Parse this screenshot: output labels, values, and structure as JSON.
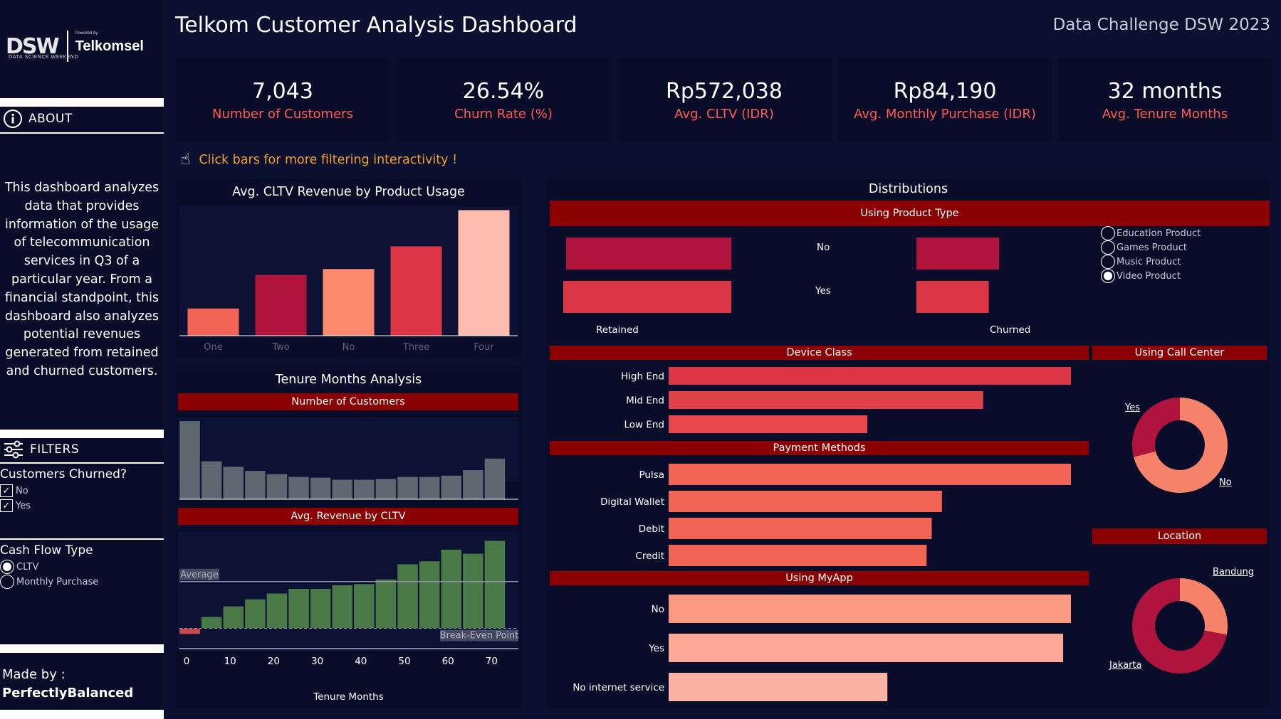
{
  "header": {
    "title": "Telkom Customer Analysis Dashboard",
    "event": "Data Challenge DSW 2023"
  },
  "logo": {
    "dsw": "DSW",
    "dsw_sub": "DATA SCIENCE WEEKEND",
    "powered": "Powered by",
    "brand": "Telkomsel"
  },
  "sidebar": {
    "about_label": "ABOUT",
    "about_text": "This dashboard analyzes data that provides information of the usage of telecommunication services in Q3 of a particular year. From a financial standpoint, this dashboard also analyzes potential revenues generated from retained and churned customers.",
    "filters_label": "FILTERS",
    "churned_title": "Customers Churned?",
    "churned_options": [
      "No",
      "Yes"
    ],
    "cashflow_title": "Cash Flow Type",
    "cashflow_options": [
      "CLTV",
      "Monthly Purchase"
    ],
    "cashflow_selected": "CLTV",
    "made_by_label": "Made by :",
    "made_by_name": "PerfectlyBalanced"
  },
  "kpis": [
    {
      "value": "7,043",
      "label": "Number of Customers"
    },
    {
      "value": "26.54%",
      "label": "Churn Rate (%)"
    },
    {
      "value": "Rp572,038",
      "label": "Avg. CLTV (IDR)"
    },
    {
      "value": "Rp84,190",
      "label": "Avg. Monthly Purchase (IDR)"
    },
    {
      "value": "32 months",
      "label": "Avg. Tenure Months"
    }
  ],
  "hint": "Click bars for more filtering interactivity !",
  "colors": {
    "accent_red": "#8b0000",
    "kpi_label": "#ff5a52",
    "hint": "#f5a02a",
    "grey_bar": "#5f6770",
    "green_bar": "#4a7a48"
  },
  "chart_data": [
    {
      "type": "bar",
      "title": "Avg. CLTV Revenue by Product Usage",
      "categories": [
        "One",
        "Two",
        "No",
        "Three",
        "Four"
      ],
      "values": [
        210000,
        470000,
        515000,
        690000,
        970000
      ],
      "colors": [
        "#f26455",
        "#b0143c",
        "#fb8a6f",
        "#dc3545",
        "#fdbcae"
      ],
      "ylim": [
        0,
        1000000
      ]
    },
    {
      "type": "bar",
      "title": "Tenure Months Analysis",
      "subtitle": "Number of Customers",
      "x": [
        0,
        5,
        10,
        15,
        20,
        25,
        30,
        35,
        40,
        45,
        50,
        55,
        60,
        65,
        70
      ],
      "values": [
        1150,
        560,
        480,
        420,
        370,
        330,
        320,
        290,
        290,
        300,
        330,
        330,
        350,
        430,
        600
      ],
      "ylim": [
        0,
        1200
      ]
    },
    {
      "type": "bar",
      "subtitle": "Avg. Revenue by CLTV",
      "xlabel": "Tenure Months",
      "x": [
        0,
        5,
        10,
        15,
        20,
        25,
        30,
        35,
        40,
        45,
        50,
        55,
        60,
        65,
        70
      ],
      "x_ticks": [
        0,
        10,
        20,
        30,
        40,
        50,
        60,
        70
      ],
      "values": [
        -10,
        20,
        38,
        50,
        60,
        68,
        68,
        74,
        76,
        84,
        110,
        115,
        135,
        128,
        150
      ],
      "ylim": [
        -20,
        160
      ],
      "reference_lines": [
        {
          "label": "Average",
          "value": 80
        },
        {
          "label": "Break-Even Point",
          "value": 0
        }
      ]
    },
    {
      "type": "bar",
      "title": "Distributions",
      "subtitle": "Using Product Type",
      "categories": [
        "No",
        "Yes"
      ],
      "series": [
        {
          "name": "Retained",
          "values": [
            2900,
            2950
          ]
        },
        {
          "name": "Churned",
          "values": [
            1450,
            1270
          ]
        }
      ],
      "legend": [
        "Education Product",
        "Games Product",
        "Music Product",
        "Video Product"
      ],
      "legend_selected": "Video Product"
    },
    {
      "type": "bar",
      "subtitle": "Device Class",
      "categories": [
        "High End",
        "Mid End",
        "Low End"
      ],
      "values": [
        3300,
        2580,
        1630
      ]
    },
    {
      "type": "bar",
      "subtitle": "Payment Methods",
      "categories": [
        "Pulsa",
        "Digital Wallet",
        "Debit",
        "Credit"
      ],
      "values": [
        2370,
        1610,
        1550,
        1520
      ]
    },
    {
      "type": "bar",
      "subtitle": "Using MyApp",
      "categories": [
        "No",
        "Yes",
        "No internet service"
      ],
      "values": [
        3090,
        3030,
        1680
      ]
    },
    {
      "type": "pie",
      "subtitle": "Using Call Center",
      "categories": [
        "Yes",
        "No"
      ],
      "values": [
        29,
        71
      ],
      "colors": [
        "#b0143c",
        "#f6826a"
      ]
    },
    {
      "type": "pie",
      "subtitle": "Location",
      "categories": [
        "Bandung",
        "Jakarta"
      ],
      "values": [
        28,
        72
      ],
      "colors": [
        "#f6826a",
        "#b0143c"
      ]
    }
  ]
}
